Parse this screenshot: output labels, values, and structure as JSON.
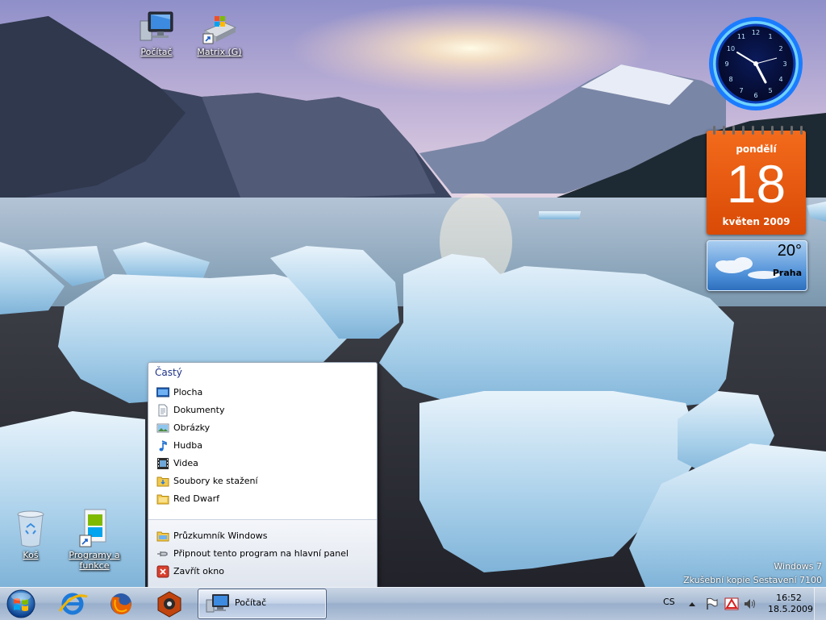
{
  "desktop": {
    "icons": [
      {
        "label": "Počítač",
        "icon": "computer-icon"
      },
      {
        "label": "Matrix (G)",
        "icon": "drive-shortcut-icon"
      },
      {
        "label": "Koš",
        "icon": "recycle-bin-icon"
      },
      {
        "label": "Programy a funkce",
        "icon": "programs-features-icon"
      }
    ]
  },
  "gadgets": {
    "calendar": {
      "day_name": "pondělí",
      "day_number": "18",
      "month_year": "květen 2009"
    },
    "weather": {
      "temperature": "20°",
      "city": "Praha"
    }
  },
  "watermark": {
    "line1": "Windows 7",
    "line2": "Zkušební kopie Sestavení 7100"
  },
  "jumplist": {
    "heading": "Častý",
    "frequent": [
      {
        "label": "Plocha",
        "icon": "desktop-icon"
      },
      {
        "label": "Dokumenty",
        "icon": "document-icon"
      },
      {
        "label": "Obrázky",
        "icon": "pictures-icon"
      },
      {
        "label": "Hudba",
        "icon": "music-icon"
      },
      {
        "label": "Videa",
        "icon": "video-icon"
      },
      {
        "label": "Soubory ke stažení",
        "icon": "folder-icon"
      },
      {
        "label": "Red Dwarf",
        "icon": "folder-icon"
      }
    ],
    "tasks": [
      {
        "label": "Průzkumník Windows",
        "icon": "explorer-icon"
      },
      {
        "label": "Připnout tento program na hlavní panel",
        "icon": "pin-icon"
      },
      {
        "label": "Zavřít okno",
        "icon": "close-icon"
      }
    ]
  },
  "taskbar": {
    "pinned": [
      "internet-explorer-icon",
      "firefox-icon",
      "reason-icon"
    ],
    "active_task": "Počítač",
    "language": "CS",
    "time": "16:52",
    "date": "18.5.2009"
  },
  "colors": {
    "jumplist_heading": "#1e3287",
    "calendar": "#e95d10",
    "taskbar": "#a9bcd4"
  }
}
